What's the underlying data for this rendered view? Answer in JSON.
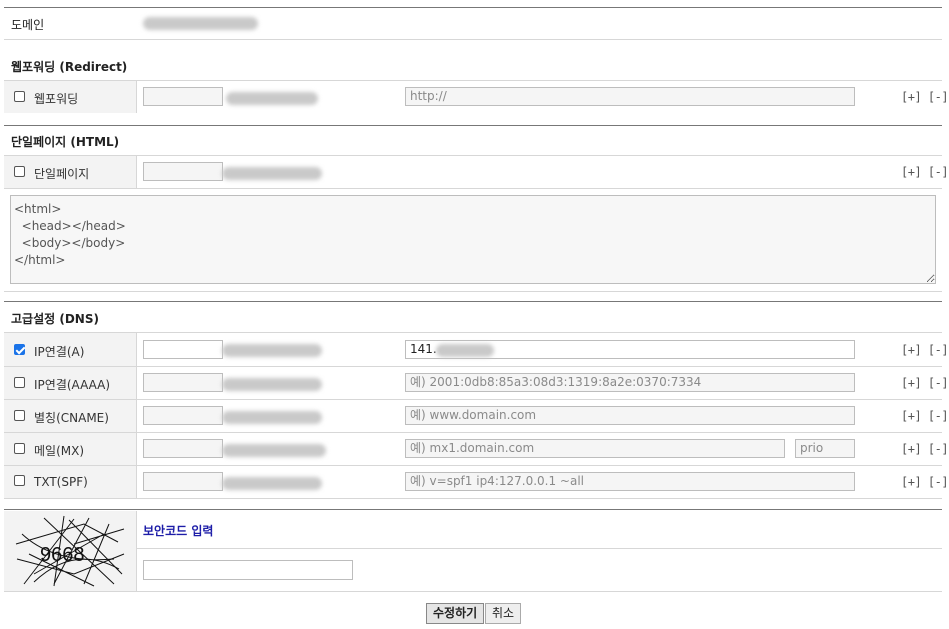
{
  "domain_row": {
    "label": "도메인"
  },
  "redirect": {
    "title": "웹포워딩 (Redirect)",
    "row": {
      "label": "웹포워딩",
      "checked": false,
      "url_placeholder": "http://"
    }
  },
  "html_page": {
    "title": "단일페이지 (HTML)",
    "row": {
      "label": "단일페이지",
      "checked": false
    },
    "code": "<html>\n  <head></head>\n  <body></body>\n</html>"
  },
  "dns": {
    "title": "고급설정 (DNS)",
    "rows": [
      {
        "label": "IP연결(A)",
        "checked": true,
        "value": "141.",
        "placeholder": ""
      },
      {
        "label": "IP연결(AAAA)",
        "checked": false,
        "value": "",
        "placeholder": "예) 2001:0db8:85a3:08d3:1319:8a2e:0370:7334"
      },
      {
        "label": "별칭(CNAME)",
        "checked": false,
        "value": "",
        "placeholder": "예) www.domain.com"
      },
      {
        "label": "메일(MX)",
        "checked": false,
        "value": "",
        "placeholder": "예) mx1.domain.com",
        "prio_placeholder": "prio"
      },
      {
        "label": "TXT(SPF)",
        "checked": false,
        "value": "",
        "placeholder": "예) v=spf1 ip4:127.0.0.1 ~all"
      }
    ]
  },
  "row_actions": {
    "add": "[+]",
    "remove": "[-]"
  },
  "captcha": {
    "code": "9668",
    "label": "보안코드 입력"
  },
  "buttons": {
    "submit": "수정하기",
    "cancel": "취소"
  }
}
